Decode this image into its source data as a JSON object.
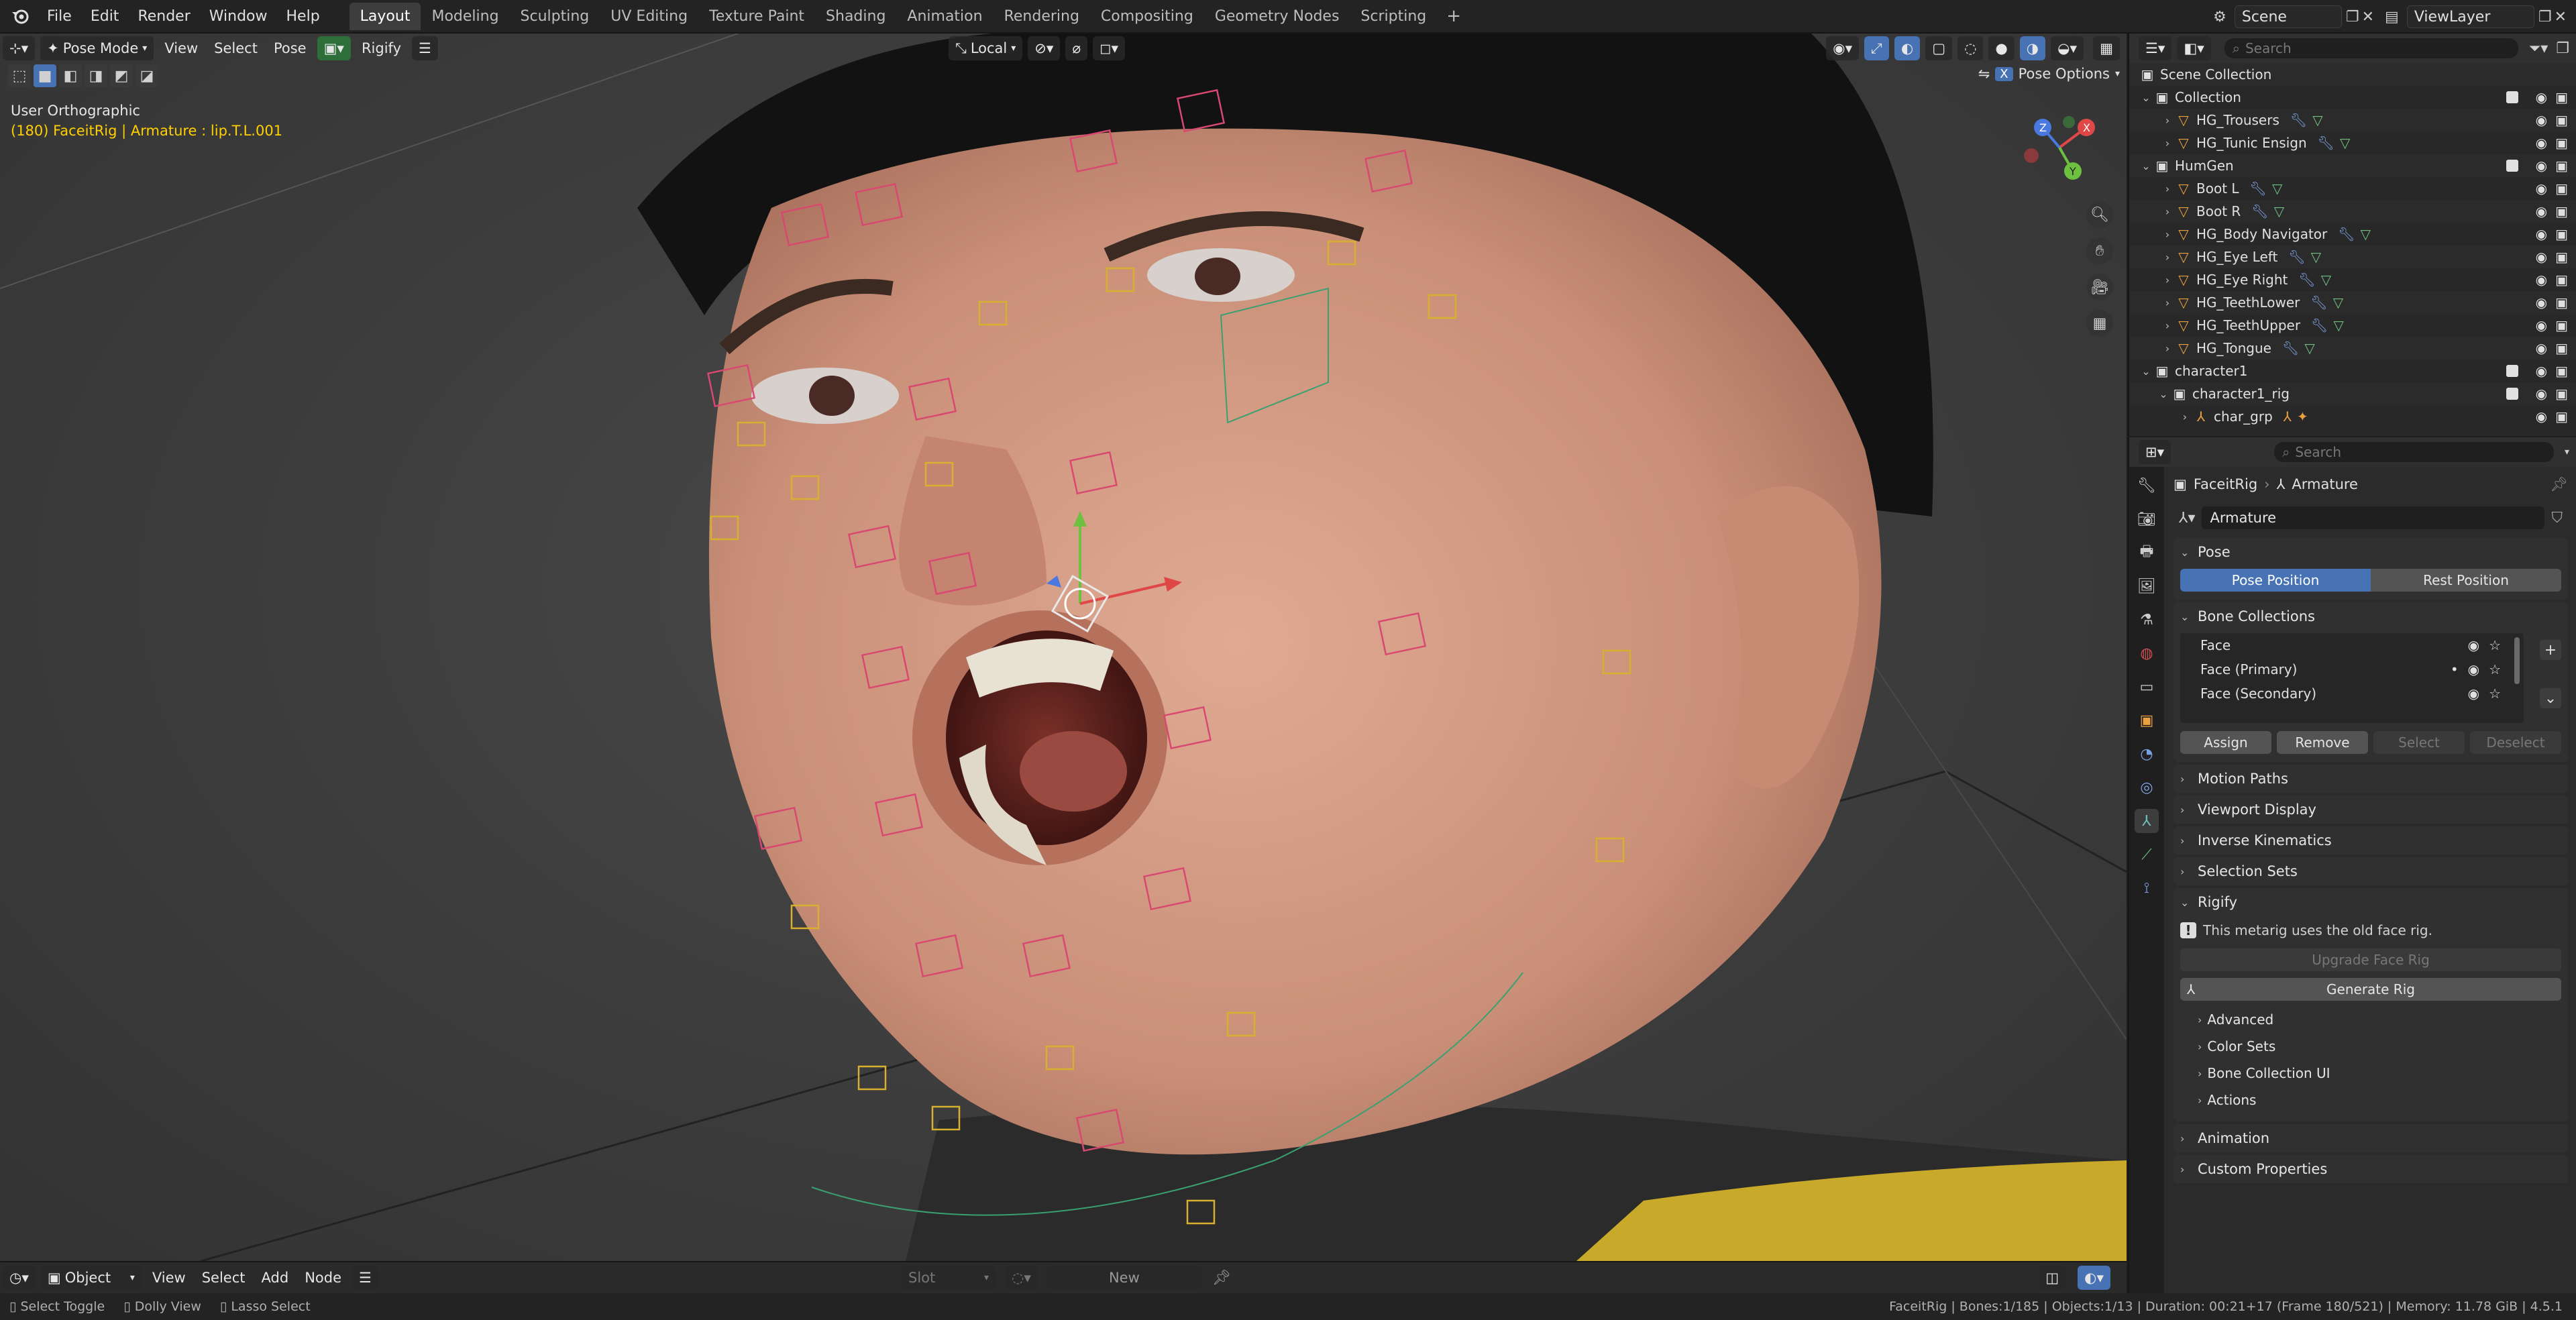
{
  "topbar": {
    "menu": [
      "File",
      "Edit",
      "Render",
      "Window",
      "Help"
    ],
    "workspaces": [
      "Layout",
      "Modeling",
      "Sculpting",
      "UV Editing",
      "Texture Paint",
      "Shading",
      "Animation",
      "Rendering",
      "Compositing",
      "Geometry Nodes",
      "Scripting"
    ],
    "active_workspace": "Layout",
    "scene": "Scene",
    "view_layer": "ViewLayer"
  },
  "viewport": {
    "mode": "Pose Mode",
    "menus": [
      "View",
      "Select",
      "Pose"
    ],
    "rigify_menu": "Rigify",
    "transform_orientation": "Local",
    "view_label": "User Orthographic",
    "active_info": "(180) FaceitRig | Armature : lip.T.L.001",
    "pose_options": "Pose Options",
    "x_label": "X"
  },
  "timeline": {
    "editor": "Object",
    "menus": [
      "View",
      "Select",
      "Add",
      "Node"
    ],
    "slot_placeholder": "Slot",
    "new_label": "New"
  },
  "statusbar": {
    "left": [
      "Select Toggle",
      "Dolly View",
      "Lasso Select"
    ],
    "right": "FaceitRig | Bones:1/185 | Objects:1/13 | Duration: 00:21+17 (Frame 180/521) | Memory: 11.78 GiB | 4.5.1"
  },
  "outliner": {
    "search_placeholder": "Search",
    "rows": [
      {
        "label": "Scene Collection",
        "indent": 0,
        "type": "scene"
      },
      {
        "label": "Collection",
        "indent": 1,
        "type": "collection"
      },
      {
        "label": "HG_Trousers",
        "indent": 2,
        "type": "object"
      },
      {
        "label": "HG_Tunic Ensign",
        "indent": 2,
        "type": "object"
      },
      {
        "label": "HumGen",
        "indent": 1,
        "type": "collection"
      },
      {
        "label": "Boot L",
        "indent": 2,
        "type": "object"
      },
      {
        "label": "Boot R",
        "indent": 2,
        "type": "object"
      },
      {
        "label": "HG_Body Navigator",
        "indent": 2,
        "type": "object"
      },
      {
        "label": "HG_Eye Left",
        "indent": 2,
        "type": "object"
      },
      {
        "label": "HG_Eye Right",
        "indent": 2,
        "type": "object"
      },
      {
        "label": "HG_TeethLower",
        "indent": 2,
        "type": "object"
      },
      {
        "label": "HG_TeethUpper",
        "indent": 2,
        "type": "object"
      },
      {
        "label": "HG_Tongue",
        "indent": 2,
        "type": "object"
      },
      {
        "label": "character1",
        "indent": 1,
        "type": "collection"
      },
      {
        "label": "character1_rig",
        "indent": 2,
        "type": "collection"
      },
      {
        "label": "char_grp",
        "indent": 3,
        "type": "armature"
      }
    ]
  },
  "properties": {
    "search_placeholder": "Search",
    "crumb_object": "FaceitRig",
    "crumb_data": "Armature",
    "data_name": "Armature",
    "pose_panel": "Pose",
    "pose_position": "Pose Position",
    "rest_position": "Rest Position",
    "bone_collections_panel": "Bone Collections",
    "bone_collections": [
      "Face",
      "Face (Primary)",
      "Face (Secondary)"
    ],
    "assign": "Assign",
    "remove": "Remove",
    "select": "Select",
    "deselect": "Deselect",
    "motion_paths": "Motion Paths",
    "viewport_display": "Viewport Display",
    "inverse_kinematics": "Inverse Kinematics",
    "selection_sets": "Selection Sets",
    "rigify_panel": "Rigify",
    "rigify_info": "This metarig uses the old face rig.",
    "upgrade_face_rig": "Upgrade Face Rig",
    "generate_rig": "Generate Rig",
    "advanced": "Advanced",
    "color_sets": "Color Sets",
    "bone_collection_ui": "Bone Collection UI",
    "actions": "Actions",
    "animation": "Animation",
    "custom_properties": "Custom Properties"
  },
  "colors": {
    "accent": "#4772b3",
    "active_text": "#ffd000",
    "skin": "#d9a48c",
    "shirt": "#c9a92a"
  }
}
